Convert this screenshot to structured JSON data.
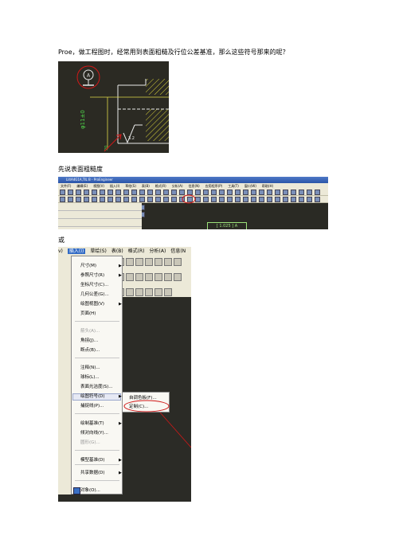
{
  "paragraphs": {
    "intro": "Proe，做工程图时，经常用到表面粗糙及行位公差基准，那么这些符号那来的呢？",
    "roughness": "先说表面粗糙度",
    "or": "或"
  },
  "figure1": {
    "datum_label": "A",
    "dim_vertical": "φ11±0",
    "dim_small": "20",
    "roughness_value": "3.2"
  },
  "figure2": {
    "title": "LI4A4G1A,TIL B  - ProEngineer",
    "menus": [
      "文件(F)",
      "编辑(E)",
      "视图(V)",
      "插入(I)",
      "草绘(S)",
      "表(B)",
      "格式(R)",
      "分析(A)",
      "信息(N)",
      "应用程序(P)",
      "工具(T)",
      "窗口(W)",
      "帮助(H)"
    ],
    "dimension": "[  1.025 ] A"
  },
  "figure3": {
    "menubar": [
      "v)",
      "插入(I)",
      "草绘(S)",
      "表(B)",
      "格式(R)",
      "分析(A)",
      "信息(N"
    ],
    "menu_items": [
      {
        "label": "尺寸(M)",
        "sub": true,
        "disabled": false
      },
      {
        "label": "参照尺寸(R)",
        "sub": true,
        "disabled": false
      },
      {
        "label": "坐标尺寸(C)...",
        "sub": false,
        "disabled": false
      },
      {
        "label": "几何公差(G)...",
        "sub": false,
        "disabled": false
      },
      {
        "label": "绘图视图(V)",
        "sub": true,
        "disabled": false
      },
      {
        "label": "页面(H)",
        "sub": false,
        "disabled": false
      },
      {
        "label": "箭头(A)...",
        "sub": false,
        "disabled": true
      },
      {
        "label": "角拐(J)...",
        "sub": false,
        "disabled": false
      },
      {
        "label": "断点(B)...",
        "sub": false,
        "disabled": false
      },
      {
        "label": "注释(N)...",
        "sub": false,
        "disabled": false
      },
      {
        "label": "球标(L)...",
        "sub": false,
        "disabled": false
      },
      {
        "label": "表面光洁度(S)...",
        "sub": false,
        "disabled": false
      },
      {
        "label": "绘图符号(D)",
        "sub": true,
        "disabled": false
      },
      {
        "label": "捕捉线(P)...",
        "sub": false,
        "disabled": false
      },
      {
        "label": "绘制基准(T)",
        "sub": true,
        "disabled": false
      },
      {
        "label": "倾对向线(Y)...",
        "sub": false,
        "disabled": false
      },
      {
        "label": "圆形(G)...",
        "sub": false,
        "disabled": true
      },
      {
        "label": "模型基准(D)",
        "sub": true,
        "disabled": false
      },
      {
        "label": "共享数据(D)",
        "sub": true,
        "disabled": false
      },
      {
        "label": "对象(O)...",
        "sub": false,
        "disabled": false
      }
    ],
    "submenu_items": [
      "自调色板(F)...",
      "定制(C)..."
    ]
  }
}
